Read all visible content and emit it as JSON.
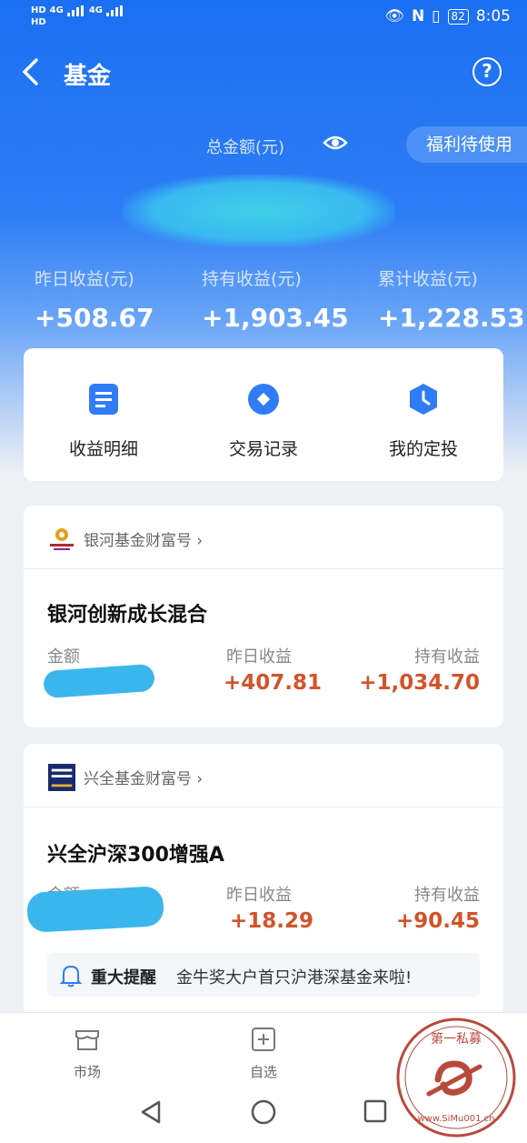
{
  "status_bar": {
    "left_lines": [
      "HD",
      "HD"
    ],
    "network": [
      "4G",
      "4G"
    ],
    "battery": "82",
    "time": "8:05"
  },
  "nav": {
    "back_icon": "chevron-left-icon",
    "title": "基金",
    "help_icon": "question-circle-icon"
  },
  "summary": {
    "total_label": "总金额(元)",
    "welfare": "福利待使用",
    "stats": [
      {
        "label": "昨日收益(元)",
        "value": "+508.67"
      },
      {
        "label": "持有收益(元)",
        "value": "+1,903.45"
      },
      {
        "label": "累计收益(元)",
        "value": "+1,228.53"
      }
    ]
  },
  "quick_actions": [
    {
      "label": "收益明细",
      "icon": "document-icon"
    },
    {
      "label": "交易记录",
      "icon": "record-icon"
    },
    {
      "label": "我的定投",
      "icon": "clock-shield-icon"
    }
  ],
  "funds": [
    {
      "brand": "银河基金财富号",
      "name": "银河创新成长混合",
      "amount_label": "金额",
      "yesterday_label": "昨日收益",
      "yesterday_value": "+407.81",
      "holding_label": "持有收益",
      "holding_value": "+1,034.70"
    },
    {
      "brand": "兴全基金财富号",
      "name": "兴全沪深300增强A",
      "amount_label": "金额",
      "yesterday_label": "昨日收益",
      "yesterday_value": "+18.29",
      "holding_label": "持有收益",
      "holding_value": "+90.45",
      "notice_title": "重大提醒",
      "notice_text": "金牛奖大户首只沪港深基金来啦!"
    }
  ],
  "tabs": [
    {
      "label": "市场",
      "icon": "market-icon"
    },
    {
      "label": "自选",
      "icon": "add-watchlist-icon"
    }
  ],
  "stamp": {
    "text_top": "第一私募",
    "text_bottom": "www.SiMu001.cn"
  },
  "colors": {
    "primary": "#1b6ff2",
    "gain": "#d2532a",
    "accent_blue": "#2f7cf6"
  }
}
